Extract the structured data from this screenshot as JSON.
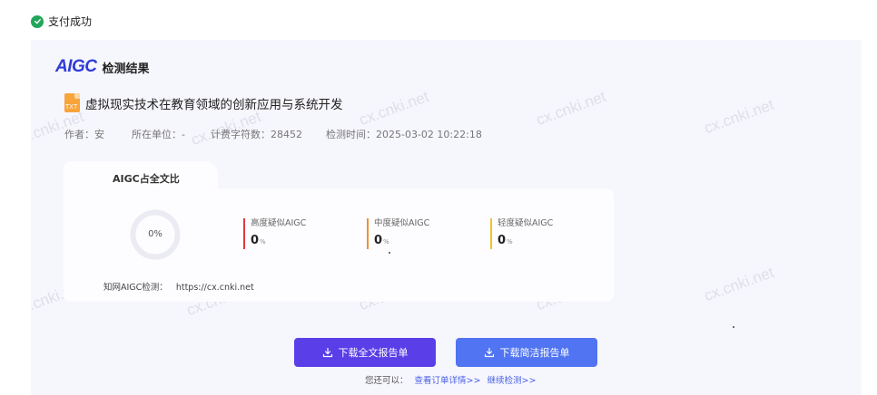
{
  "status": {
    "text": "支付成功"
  },
  "brand": {
    "logo": "AIGC",
    "title": "检测结果"
  },
  "document": {
    "file_type": "TXT",
    "title": "虚拟现实技术在教育领域的创新应用与系统开发",
    "author": "作者：安",
    "unit": "所在单位：-",
    "char_count": "计费字符数：28452",
    "check_time": "检测时间：2025-03-02 10:22:18"
  },
  "result": {
    "tab_label": "AIGC占全文比",
    "overall_percent": "0%",
    "stats": [
      {
        "name": "高度疑似AIGC",
        "value": "0",
        "unit": "%",
        "color": "#e0383e"
      },
      {
        "name": "中度疑似AIGC",
        "value": "0",
        "unit": "%",
        "color": "#f2902f"
      },
      {
        "name": "轻度疑似AIGC",
        "value": "0",
        "unit": "%",
        "color": "#f2c22f"
      }
    ],
    "site_label": "知网AIGC检测：",
    "site_url": "https://cx.cnki.net"
  },
  "actions": {
    "download_full": "下载全文报告单",
    "download_simple": "下载简洁报告单",
    "also_prefix": "您还可以：",
    "order_link": "查看订单详情>>",
    "continue_link": "继续检测>>"
  },
  "watermark": "cx.cnki.net",
  "colors": {
    "success": "#23a55a",
    "brand": "#2f3bd9",
    "btn_full": "#5a3ee8",
    "btn_simple": "#5074f2",
    "link": "#4a62e6"
  }
}
